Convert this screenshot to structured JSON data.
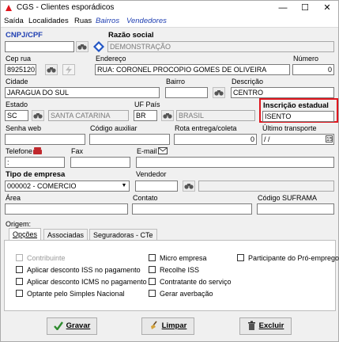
{
  "window": {
    "title": "CGS - Clientes esporádicos",
    "minimize": "—",
    "maximize": "☐",
    "close": "✕"
  },
  "menu": {
    "items": [
      "Saída",
      "Localidades",
      "Ruas",
      "Bairros",
      "Vendedores"
    ]
  },
  "form": {
    "cnpj_label": "CNPJ/CPF",
    "cnpj_value": "",
    "razao_label": "Razão social",
    "razao_value": "DEMONSTRAÇÃO",
    "cep_label": "Cep rua",
    "cep_value": "89251201",
    "endereco_label": "Endereço",
    "endereco_value": "RUA: CORONEL PROCOPIO GOMES DE OLIVEIRA",
    "numero_label": "Número",
    "numero_value": "0",
    "cidade_label": "Cidade",
    "cidade_value": "JARAGUA DO SUL",
    "bairro_label": "Bairro",
    "bairro_value": "",
    "descricao_label": "Descrição",
    "descricao_value": "CENTRO",
    "estado_label": "Estado",
    "estado_value": "SC",
    "estado_nome": "SANTA CATARINA",
    "uf_pais_label": "UF País",
    "uf_pais_value": "BR",
    "pais_nome": "BRASIL",
    "inscricao_label": "Inscrição estadual",
    "inscricao_value": "ISENTO",
    "senha_label": "Senha web",
    "senha_value": "",
    "codaux_label": "Código auxiliar",
    "codaux_value": "",
    "rota_label": "Rota entrega/coleta",
    "rota_value": "0",
    "ultimo_label": "Último transporte",
    "ultimo_value": "/ /",
    "telefone_label": "Telefone",
    "telefone_value": ":",
    "fax_label": "Fax",
    "fax_value": "",
    "email_label": "E-mail",
    "email_value": "",
    "tipo_label": "Tipo de empresa",
    "tipo_value": "000002 - COMERCIO",
    "vendedor_label": "Vendedor",
    "vendedor_value": "",
    "area_label": "Área",
    "area_value": "",
    "contato_label": "Contato",
    "contato_value": "",
    "suframa_label": "Código SUFRAMA",
    "suframa_value": "",
    "origem_label": "Origem:"
  },
  "tabs": [
    "Opções",
    "Associadas",
    "Seguradoras - CTe"
  ],
  "options_left": [
    "Contribuinte",
    "Aplicar desconto ISS no pagamento",
    "Aplicar desconto ICMS no pagamento",
    "Optante pelo Simples Nacional"
  ],
  "options_mid": [
    "Micro empresa",
    "Recolhe ISS",
    "Contratante do serviço",
    "Gerar averbação"
  ],
  "options_right": [
    "Participante do Pró-emprego"
  ],
  "buttons": {
    "save": "Gravar",
    "clear": "Limpar",
    "delete": "Excluir"
  },
  "colors": {
    "highlight": "#e0161e",
    "accent_blue": "#1f3fb2"
  }
}
